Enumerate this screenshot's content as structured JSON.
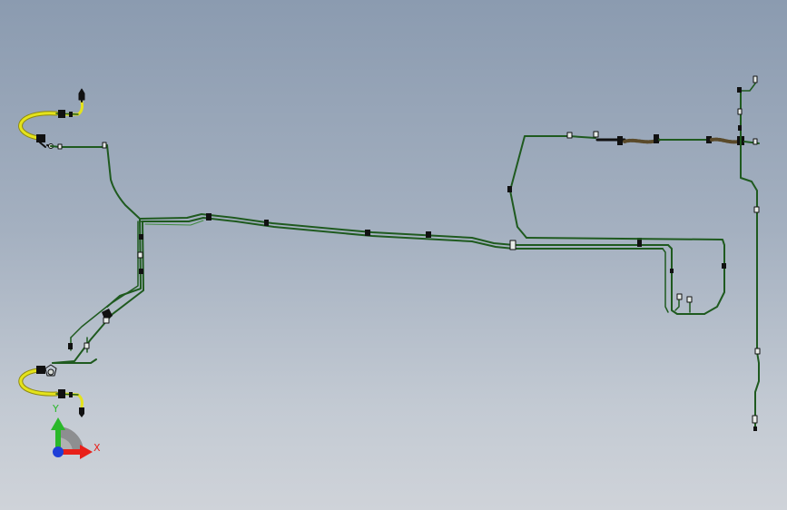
{
  "viewport": {
    "background_top": "#8b9bb0",
    "background_bottom": "#cfd3d9"
  },
  "colors": {
    "tube": "#1f5a1f",
    "tube_highlight": "#3f8a3f",
    "hose": "#e4e31c",
    "hose_outline": "#8f8a10",
    "fitting": "#111111",
    "clip_fill": "#e8ece8"
  },
  "triad": {
    "x_label": "X",
    "y_label": "Y",
    "x_color": "#e8201a",
    "y_color": "#2ab82a",
    "origin_color": "#1f3fd8"
  }
}
